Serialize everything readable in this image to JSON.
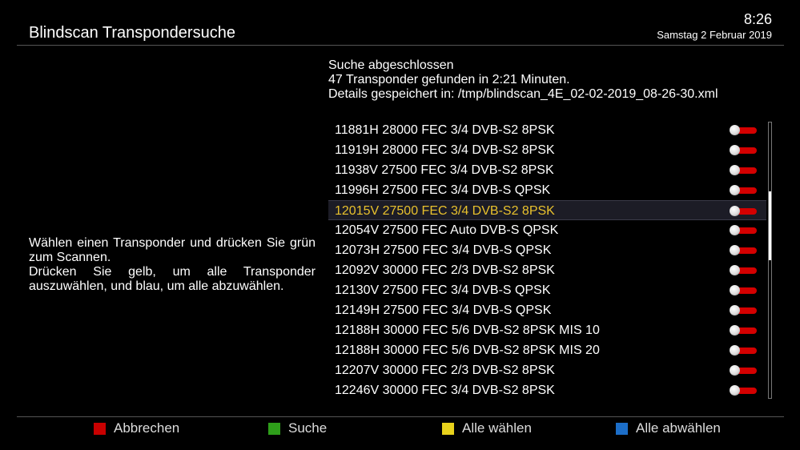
{
  "header": {
    "title": "Blindscan Transpondersuche",
    "time": "8:26",
    "date": "Samstag 2 Februar 2019"
  },
  "status": {
    "line1": "Suche abgeschlossen",
    "line2": "47 Transponder gefunden in 2:21 Minuten.",
    "line3": "Details gespeichert in: /tmp/blindscan_4E_02-02-2019_08-26-30.xml"
  },
  "help": {
    "line1": "Wählen einen Transponder und drücken Sie grün zum Scannen.",
    "line2": "Drücken Sie gelb, um alle Transponder auszuwählen, und blau, um alle abzuwählen."
  },
  "transponders": [
    {
      "label": "11881H 28000 FEC 3/4 DVB-S2 8PSK"
    },
    {
      "label": "11919H 28000 FEC 3/4 DVB-S2 8PSK"
    },
    {
      "label": "11938V 27500 FEC 3/4 DVB-S2 8PSK"
    },
    {
      "label": "11996H 27500 FEC 3/4 DVB-S QPSK"
    },
    {
      "label": "12015V 27500 FEC 3/4 DVB-S2 8PSK"
    },
    {
      "label": "12054V 27500 FEC Auto DVB-S QPSK"
    },
    {
      "label": "12073H 27500 FEC 3/4 DVB-S QPSK"
    },
    {
      "label": "12092V 30000 FEC 2/3 DVB-S2 8PSK"
    },
    {
      "label": "12130V 27500 FEC 3/4 DVB-S QPSK"
    },
    {
      "label": "12149H 27500 FEC 3/4 DVB-S QPSK"
    },
    {
      "label": "12188H 30000 FEC 5/6 DVB-S2 8PSK MIS 10"
    },
    {
      "label": "12188H 30000 FEC 5/6 DVB-S2 8PSK MIS 20"
    },
    {
      "label": "12207V 30000 FEC 2/3 DVB-S2 8PSK"
    },
    {
      "label": "12246V 30000 FEC 3/4 DVB-S2 8PSK"
    }
  ],
  "selected_index": 4,
  "footer": {
    "red_label": "Abbrechen",
    "green_label": "Suche",
    "yellow_label": "Alle wählen",
    "blue_label": "Alle abwählen"
  },
  "colors": {
    "red": "#c80000",
    "green": "#2e9e1a",
    "yellow": "#e8d21c",
    "blue": "#1c6ec8",
    "selected_text": "#e8c12d"
  }
}
